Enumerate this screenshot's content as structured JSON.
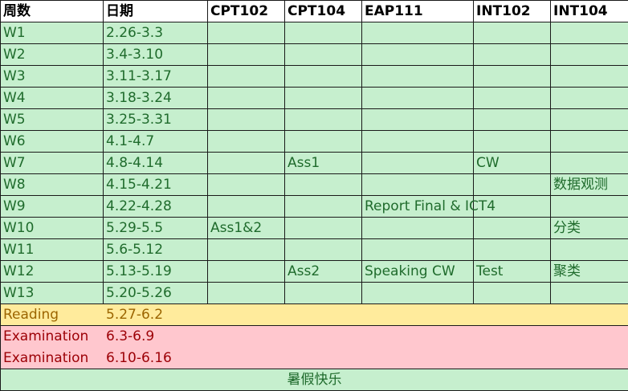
{
  "colors": {
    "header_bg": "#ffffff",
    "week_bg": "#c6efce",
    "week_text": "#1f6b2c",
    "reading_bg": "#ffeb9c",
    "reading_text": "#9c6500",
    "exam_bg": "#ffc7ce",
    "exam_text": "#9c0006"
  },
  "header": [
    "周数",
    "日期",
    "CPT102",
    "CPT104",
    "EAP111",
    "INT102",
    "INT104"
  ],
  "weeks": [
    {
      "week": "W1",
      "dates": "2.26-3.3",
      "cpt102": "",
      "cpt104": "",
      "eap111": "",
      "int102": "",
      "int104": ""
    },
    {
      "week": "W2",
      "dates": "3.4-3.10",
      "cpt102": "",
      "cpt104": "",
      "eap111": "",
      "int102": "",
      "int104": ""
    },
    {
      "week": "W3",
      "dates": "3.11-3.17",
      "cpt102": "",
      "cpt104": "",
      "eap111": "",
      "int102": "",
      "int104": ""
    },
    {
      "week": "W4",
      "dates": "3.18-3.24",
      "cpt102": "",
      "cpt104": "",
      "eap111": "",
      "int102": "",
      "int104": ""
    },
    {
      "week": "W5",
      "dates": "3.25-3.31",
      "cpt102": "",
      "cpt104": "",
      "eap111": "",
      "int102": "",
      "int104": ""
    },
    {
      "week": "W6",
      "dates": "4.1-4.7",
      "cpt102": "",
      "cpt104": "",
      "eap111": "",
      "int102": "",
      "int104": ""
    },
    {
      "week": "W7",
      "dates": "4.8-4.14",
      "cpt102": "",
      "cpt104": "Ass1",
      "eap111": "",
      "int102": "CW",
      "int104": ""
    },
    {
      "week": "W8",
      "dates": "4.15-4.21",
      "cpt102": "",
      "cpt104": "",
      "eap111": "",
      "int102": "",
      "int104": "数据观测"
    },
    {
      "week": "W9",
      "dates": "4.22-4.28",
      "cpt102": "",
      "cpt104": "",
      "eap111": "Report Final & ICT4",
      "int102": "",
      "int104": ""
    },
    {
      "week": "W10",
      "dates": "5.29-5.5",
      "cpt102": "Ass1&2",
      "cpt104": "",
      "eap111": "",
      "int102": "",
      "int104": "分类"
    },
    {
      "week": "W11",
      "dates": "5.6-5.12",
      "cpt102": "",
      "cpt104": "",
      "eap111": "",
      "int102": "",
      "int104": ""
    },
    {
      "week": "W12",
      "dates": "5.13-5.19",
      "cpt102": "",
      "cpt104": "Ass2",
      "eap111": "Speaking CW",
      "int102": "Test",
      "int104": "聚类"
    },
    {
      "week": "W13",
      "dates": "5.20-5.26",
      "cpt102": "",
      "cpt104": "",
      "eap111": "",
      "int102": "",
      "int104": ""
    }
  ],
  "reading": {
    "label": "Reading",
    "dates": "5.27-6.2"
  },
  "exams": [
    {
      "label": "Examination",
      "dates": "6.3-6.9"
    },
    {
      "label": "Examination",
      "dates": "6.10-6.16"
    }
  ],
  "footer": "暑假快乐"
}
